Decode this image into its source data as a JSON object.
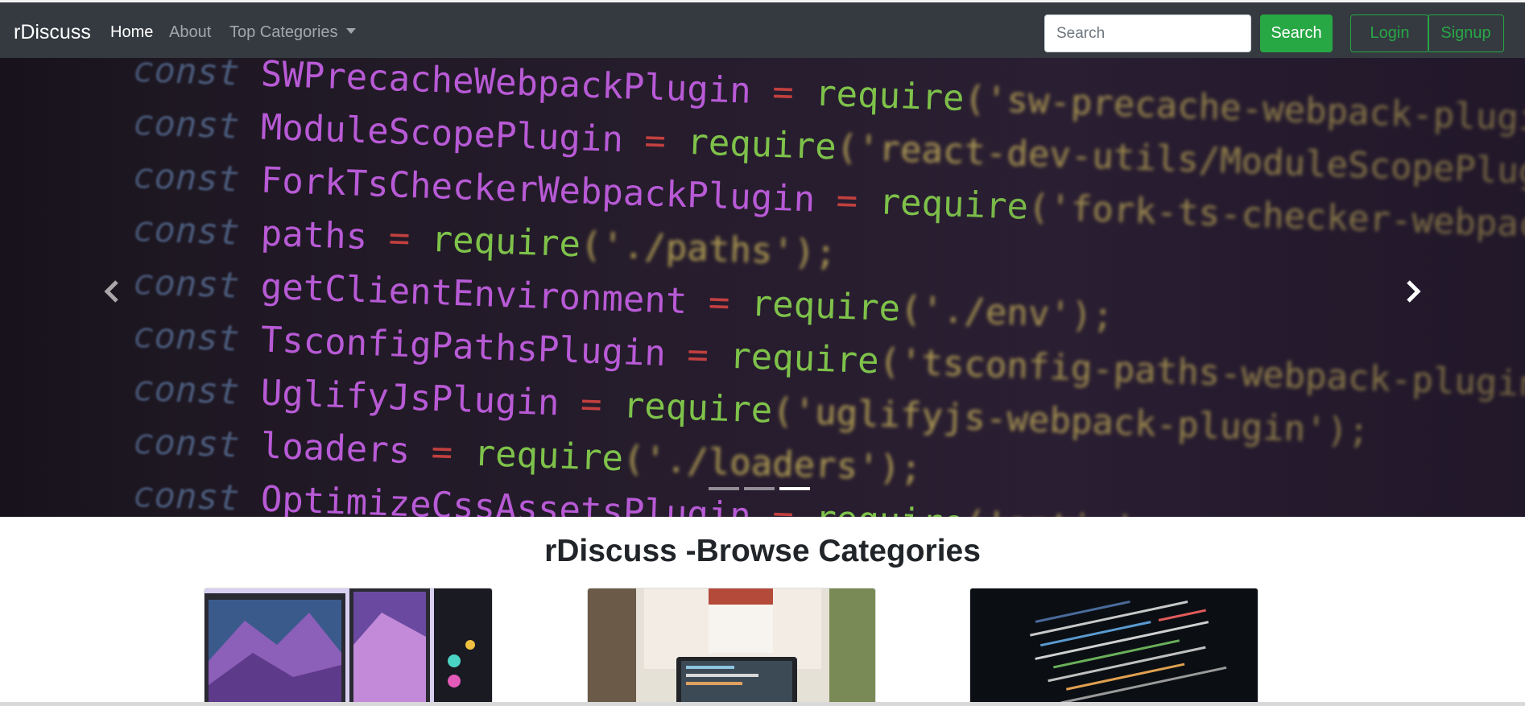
{
  "navbar": {
    "brand": "rDiscuss",
    "links": [
      {
        "label": "Home"
      },
      {
        "label": "About"
      },
      {
        "label": "Top Categories"
      }
    ],
    "search": {
      "placeholder": "Search",
      "button_label": "Search"
    },
    "login_label": "Login",
    "signup_label": "Signup"
  },
  "carousel": {
    "indicators": 3,
    "active_index": 2,
    "code_lines": [
      {
        "kw": "const",
        "id": "SWPrecacheWebpackPlugin",
        "op": "=",
        "fn": "require",
        "str": "('sw-precache-webpack-plugin');"
      },
      {
        "kw": "const",
        "id": "ModuleScopePlugin",
        "op": "=",
        "fn": "require",
        "str": "('react-dev-utils/ModuleScopePlugin');"
      },
      {
        "kw": "const",
        "id": "ForkTsCheckerWebpackPlugin",
        "op": "=",
        "fn": "require",
        "str": "('fork-ts-checker-webpack-plugin');"
      },
      {
        "kw": "const",
        "id": "paths",
        "op": "=",
        "fn": "require",
        "str": "('./paths');"
      },
      {
        "kw": "const",
        "id": "getClientEnvironment",
        "op": "=",
        "fn": "require",
        "str": "('./env');"
      },
      {
        "kw": "const",
        "id": "TsconfigPathsPlugin",
        "op": "=",
        "fn": "require",
        "str": "('tsconfig-paths-webpack-plugin');"
      },
      {
        "kw": "const",
        "id": "UglifyJsPlugin",
        "op": "=",
        "fn": "require",
        "str": "('uglifyjs-webpack-plugin');"
      },
      {
        "kw": "const",
        "id": "loaders",
        "op": "=",
        "fn": "require",
        "str": "('./loaders');"
      },
      {
        "kw": "const",
        "id": "OptimizeCssAssetsPlugin",
        "op": "=",
        "fn": "require",
        "str": "('optimize-css-assets-webpack-plugin');"
      }
    ]
  },
  "categories": {
    "title": "rDiscuss -Browse Categories"
  },
  "colors": {
    "navbar_bg": "#343a40",
    "accent_green": "#28a745"
  }
}
